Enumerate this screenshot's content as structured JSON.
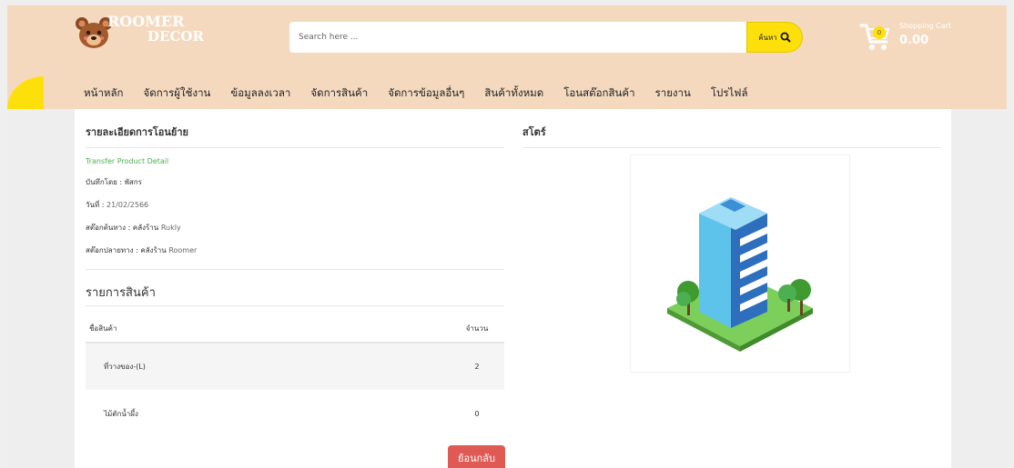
{
  "brand": {
    "line1": "ROOMER",
    "line2": "DECOR"
  },
  "search": {
    "placeholder": "Search here ...",
    "button_label": "ค้นหา"
  },
  "cart": {
    "count": "0",
    "label": "Shopping Cart",
    "total": "0.00"
  },
  "nav": [
    "หน้าหลัก",
    "จัดการผู้ใช้งาน",
    "ข้อมูลลงเวลา",
    "จัดการสินค้า",
    "จัดการข้อมูลอื่นๆ",
    "สินค้าทั้งหมด",
    "โอนสต๊อกสินค้า",
    "รายงาน",
    "โปรไฟล์"
  ],
  "detail": {
    "heading": "รายละเอียดการโอนย้าย",
    "subtitle": "Transfer Product Detail",
    "recorded_by_label": "บันทึกโดย :",
    "recorded_by": "พัสกร",
    "date_label": "วันที่ :",
    "date": "21/02/2566",
    "source_label": "สต๊อกต้นทาง : คลังร้าน",
    "source": "Rukly",
    "destination_label": "สต๊อกปลายทาง : คลังร้าน",
    "destination": "Roomer"
  },
  "product_list": {
    "heading": "รายการสินค้า",
    "columns": [
      "ชื่อสินค้า",
      "จำนวน"
    ],
    "rows": [
      {
        "name": "ที่วางของ-(L)",
        "qty": "2"
      },
      {
        "name": "ไม้ตักน้ำผึ้ง",
        "qty": "0"
      }
    ]
  },
  "back_button": "ย้อนกลับ",
  "store": {
    "heading": "สโตร์"
  },
  "colors": {
    "header": "#f4d9bf",
    "accent": "#fde00a",
    "danger": "#e05a55",
    "success": "#4caf50"
  }
}
